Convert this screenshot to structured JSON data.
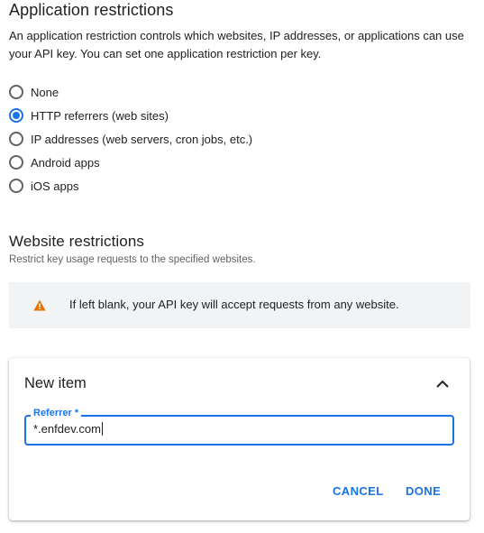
{
  "app_restrictions": {
    "title": "Application restrictions",
    "description": "An application restriction controls which websites, IP addresses, or applications can use your API key. You can set one application restriction per key.",
    "options": [
      {
        "label": "None",
        "checked": false
      },
      {
        "label": "HTTP referrers (web sites)",
        "checked": true
      },
      {
        "label": "IP addresses (web servers, cron jobs, etc.)",
        "checked": false
      },
      {
        "label": "Android apps",
        "checked": false
      },
      {
        "label": "iOS apps",
        "checked": false
      }
    ]
  },
  "website_restrictions": {
    "title": "Website restrictions",
    "subtitle": "Restrict key usage requests to the specified websites.",
    "warning": {
      "icon": "warning-icon",
      "text": "If left blank, your API key will accept requests from any website."
    }
  },
  "new_item_card": {
    "title": "New item",
    "collapse_icon": "chevron-up-icon",
    "referrer_field": {
      "label": "Referrer *",
      "value": "*.enfdev.com"
    },
    "cancel_label": "CANCEL",
    "done_label": "DONE"
  },
  "colors": {
    "accent": "#1a73e8",
    "warning": "#e37400",
    "text": "#202124",
    "secondary_text": "#5f6368"
  }
}
